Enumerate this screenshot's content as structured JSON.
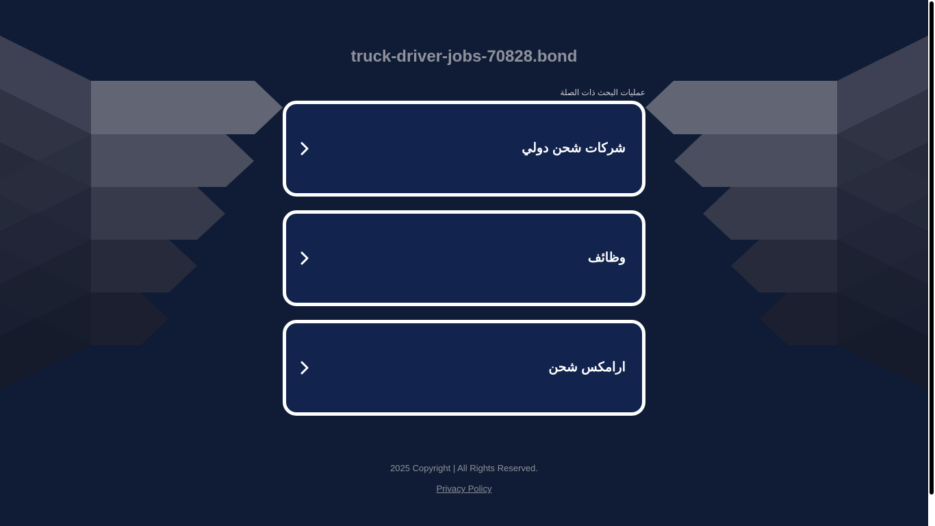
{
  "domain_title": "truck-driver-jobs-70828.bond",
  "related_searches_label": "عمليات البحث ذات الصلة",
  "links": [
    {
      "label": "شركات شحن دولي"
    },
    {
      "label": "وظائف"
    },
    {
      "label": "ارامكس شحن"
    }
  ],
  "footer": {
    "copyright": "2025 Copyright | All Rights Reserved.",
    "privacy_label": "Privacy Policy"
  },
  "colors": {
    "background": "#101c36",
    "link_box_fill": "#12244e",
    "link_box_border": "#ffffff",
    "title_text": "#8e929c"
  },
  "icons": {
    "link_arrow": "chevron-right-icon"
  }
}
